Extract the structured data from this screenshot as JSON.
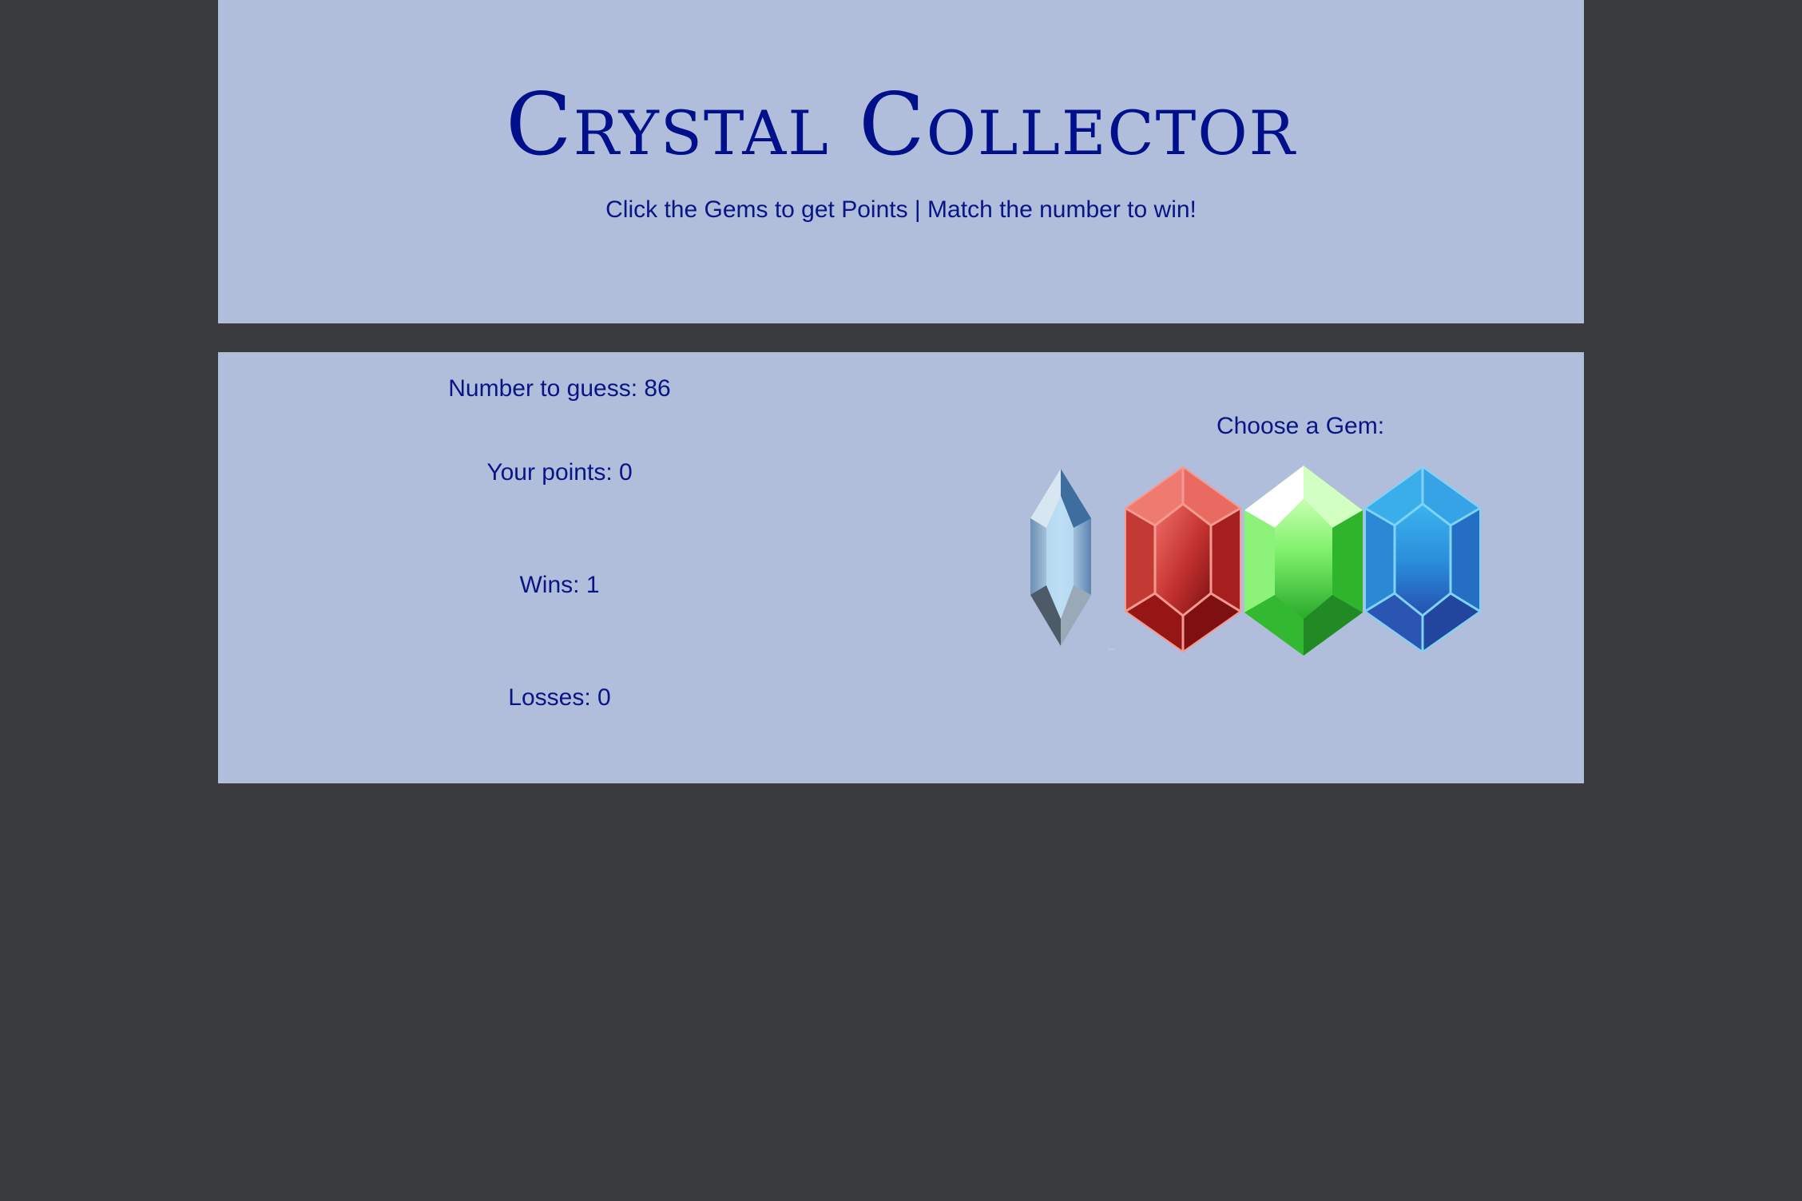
{
  "header": {
    "title": "Crystal Collector",
    "subtitle": "Click the Gems to get Points | Match the number to win!"
  },
  "stats": {
    "number_to_guess": "Number to guess: 86",
    "your_points": "Your points: 0",
    "wins": "Wins: 1",
    "losses": "Losses: 0"
  },
  "gems": {
    "label": "Choose a Gem:",
    "items": [
      {
        "name": "crystal-gem",
        "color": "#8fb2d6"
      },
      {
        "name": "red-gem",
        "color": "#d23a3a"
      },
      {
        "name": "green-gem",
        "color": "#3fbf3a"
      },
      {
        "name": "blue-gem",
        "color": "#2a7fd4"
      }
    ]
  },
  "colors": {
    "background": "#3a3b3f",
    "panel": "#b0bedb",
    "text": "#0a1585",
    "title": "#000f8a"
  }
}
